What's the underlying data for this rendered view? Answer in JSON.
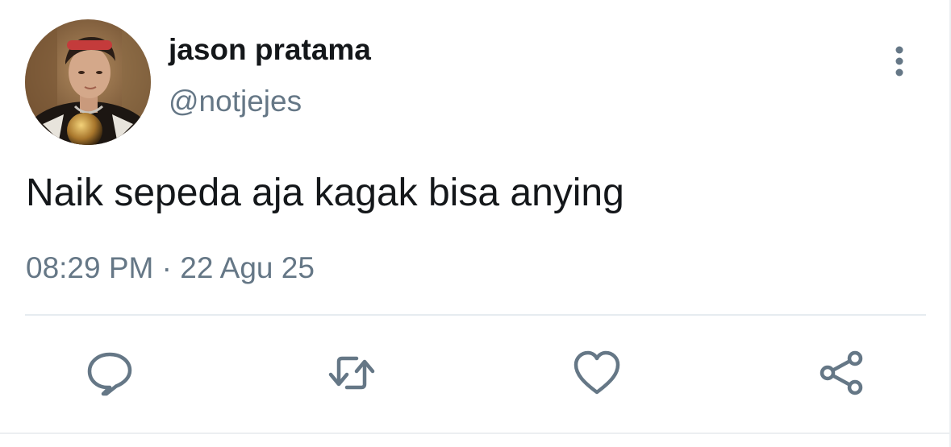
{
  "tweet": {
    "display_name": "jason pratama",
    "handle": "@notjejes",
    "text": "Naik sepeda aja kagak bisa anying",
    "time": "08:29 PM",
    "separator": "·",
    "date": "22 Agu 25"
  },
  "icons": {
    "more": "vertical-ellipsis-icon",
    "reply": "comment-bubble-icon",
    "retweet": "retweet-icon",
    "like": "heart-icon",
    "share": "share-icon"
  },
  "colors": {
    "text_primary": "#14171a",
    "text_secondary": "#657786",
    "icon": "#657786",
    "divider": "#e6ecf0",
    "background": "#ffffff"
  }
}
